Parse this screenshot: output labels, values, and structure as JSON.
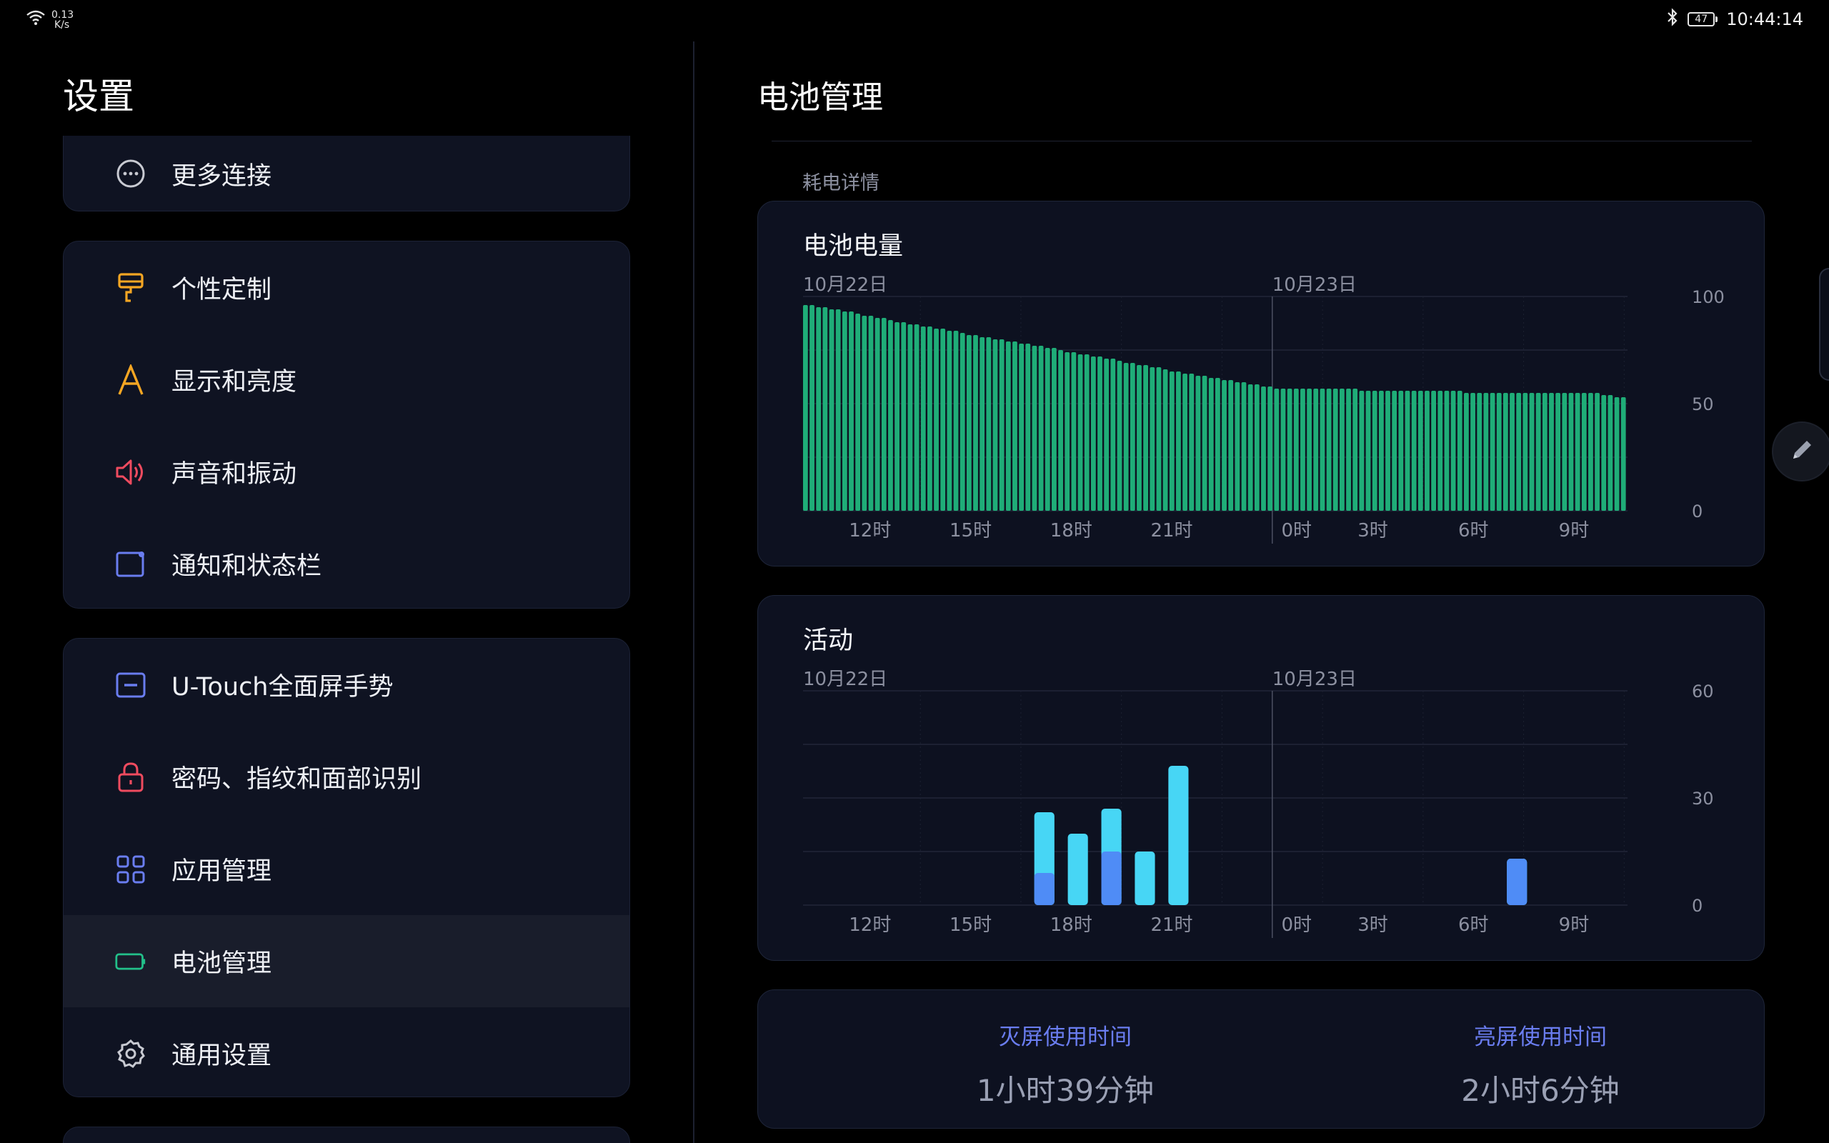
{
  "status_bar": {
    "net_speed": "0.13",
    "net_unit": "K/s",
    "battery_level": "47",
    "time": "10:44:14"
  },
  "left": {
    "title": "设置",
    "top_group": [
      {
        "label": "更多连接",
        "icon": "more-connections-icon"
      }
    ],
    "group1": [
      {
        "label": "个性定制",
        "icon": "paint-roller-icon",
        "color": "#f5a623"
      },
      {
        "label": "显示和亮度",
        "icon": "display-letter-a-icon",
        "color": "#f5a623"
      },
      {
        "label": "声音和振动",
        "icon": "speaker-icon",
        "color": "#ef4b5f"
      },
      {
        "label": "通知和状态栏",
        "icon": "notification-icon",
        "color": "#6a7df0"
      }
    ],
    "group2": [
      {
        "label": "U-Touch全面屏手势",
        "icon": "gesture-icon",
        "color": "#6a7df0"
      },
      {
        "label": "密码、指纹和面部识别",
        "icon": "lock-icon",
        "color": "#ef4b5f"
      },
      {
        "label": "应用管理",
        "icon": "apps-grid-icon",
        "color": "#6a7df0"
      },
      {
        "label": "电池管理",
        "icon": "battery-icon",
        "color": "#22c08a"
      },
      {
        "label": "通用设置",
        "icon": "gear-icon",
        "color": "#c8cad2"
      }
    ]
  },
  "right": {
    "title": "电池管理",
    "section_label": "耗电详情",
    "screen_off_label": "灭屏使用时间",
    "screen_off_value": "1小时39分钟",
    "screen_on_label": "亮屏使用时间",
    "screen_on_value": "2小时6分钟"
  },
  "colors": {
    "battery_bar": "#1fad78",
    "activity_screen_on": "#47d6f5",
    "activity_screen_off": "#4f8cf6",
    "accent": "#6a7df0"
  },
  "chart_data": [
    {
      "type": "bar",
      "title": "电池电量",
      "date_labels": [
        "10月22日",
        "10月23日"
      ],
      "x_ticks": [
        "12时",
        "15时",
        "18时",
        "21时",
        "0时",
        "3时",
        "6时",
        "9时"
      ],
      "y_ticks": [
        "100",
        "50",
        "0"
      ],
      "ylim": [
        0,
        100
      ],
      "x_range_hours": [
        10,
        34.6
      ],
      "bar_interval_hours": 0.25,
      "values": [
        96,
        96,
        95,
        95,
        94,
        94,
        93,
        93,
        92,
        91,
        91,
        90,
        90,
        89,
        88,
        88,
        87,
        87,
        86,
        86,
        85,
        85,
        84,
        84,
        83,
        82,
        82,
        81,
        81,
        80,
        80,
        79,
        79,
        78,
        78,
        77,
        77,
        76,
        76,
        75,
        74,
        74,
        73,
        73,
        72,
        72,
        71,
        71,
        70,
        69,
        69,
        68,
        68,
        67,
        67,
        66,
        65,
        65,
        64,
        64,
        63,
        63,
        62,
        62,
        61,
        61,
        60,
        60,
        59,
        59,
        58,
        58,
        57,
        57,
        57,
        57,
        57,
        57,
        57,
        57,
        57,
        57,
        57,
        57,
        57,
        56,
        56,
        56,
        56,
        56,
        56,
        56,
        56,
        56,
        56,
        56,
        56,
        56,
        56,
        56,
        56,
        55,
        55,
        55,
        55,
        55,
        55,
        55,
        55,
        55,
        55,
        55,
        55,
        55,
        55,
        55,
        55,
        55,
        55,
        55,
        55,
        55,
        54,
        54,
        53,
        53
      ]
    },
    {
      "type": "bar",
      "title": "活动",
      "date_labels": [
        "10月22日",
        "10月23日"
      ],
      "x_ticks": [
        "12时",
        "15时",
        "18时",
        "21时",
        "0时",
        "3时",
        "6时",
        "9时"
      ],
      "y_ticks": [
        "60",
        "30",
        "0"
      ],
      "ylim": [
        0,
        60
      ],
      "bar_width_hours": 0.6,
      "series": [
        {
          "x_hours": [
            17.2,
            18.2,
            19.2,
            20.2,
            21.2,
            31.3
          ],
          "values": [
            26,
            20,
            27,
            15,
            39,
            13
          ]
        },
        {
          "x_hours": [
            17.2,
            18.2,
            19.2,
            20.2,
            21.2,
            31.3
          ],
          "values": [
            9,
            0,
            15,
            0,
            0,
            13
          ]
        }
      ]
    }
  ]
}
